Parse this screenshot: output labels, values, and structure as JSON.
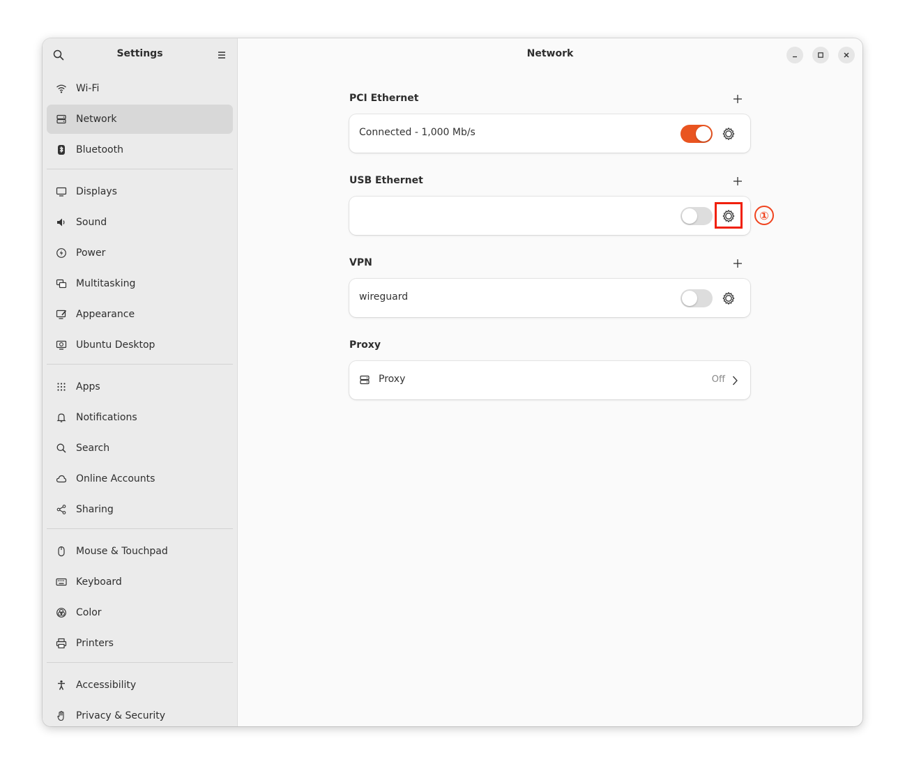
{
  "sidebar": {
    "title": "Settings",
    "search_icon": "search-icon",
    "menu_icon": "hamburger-menu-icon",
    "groups": [
      [
        {
          "label": "Wi-Fi",
          "icon": "wifi-icon"
        },
        {
          "label": "Network",
          "icon": "network-icon",
          "active": true
        },
        {
          "label": "Bluetooth",
          "icon": "bluetooth-icon"
        }
      ],
      [
        {
          "label": "Displays",
          "icon": "display-icon"
        },
        {
          "label": "Sound",
          "icon": "speaker-icon"
        },
        {
          "label": "Power",
          "icon": "power-icon"
        },
        {
          "label": "Multitasking",
          "icon": "multitasking-icon"
        },
        {
          "label": "Appearance",
          "icon": "appearance-icon"
        },
        {
          "label": "Ubuntu Desktop",
          "icon": "ubuntu-desktop-icon"
        }
      ],
      [
        {
          "label": "Apps",
          "icon": "apps-grid-icon"
        },
        {
          "label": "Notifications",
          "icon": "bell-icon"
        },
        {
          "label": "Search",
          "icon": "search-icon"
        },
        {
          "label": "Online Accounts",
          "icon": "cloud-icon"
        },
        {
          "label": "Sharing",
          "icon": "share-icon"
        }
      ],
      [
        {
          "label": "Mouse & Touchpad",
          "icon": "mouse-icon"
        },
        {
          "label": "Keyboard",
          "icon": "keyboard-icon"
        },
        {
          "label": "Color",
          "icon": "color-icon"
        },
        {
          "label": "Printers",
          "icon": "printer-icon"
        }
      ],
      [
        {
          "label": "Accessibility",
          "icon": "accessibility-icon"
        },
        {
          "label": "Privacy & Security",
          "icon": "hand-icon"
        }
      ]
    ]
  },
  "main": {
    "title": "Network",
    "window_controls": [
      "minimize-icon",
      "maximize-icon",
      "close-icon"
    ],
    "sections": {
      "pci": {
        "label": "PCI Ethernet",
        "status": "Connected - 1,000 Mb/s",
        "toggle_on": true
      },
      "usb": {
        "label": "USB Ethernet",
        "status": "",
        "toggle_on": false
      },
      "vpn": {
        "label": "VPN",
        "status": "wireguard",
        "toggle_on": false
      },
      "proxy": {
        "label": "Proxy",
        "row_label": "Proxy",
        "state": "Off"
      }
    },
    "annotation": {
      "marker": "①",
      "color": "#f0200a"
    }
  },
  "colors": {
    "accent": "#e95420",
    "sidebar_bg": "#ebebeb",
    "content_bg": "#fafafa"
  }
}
